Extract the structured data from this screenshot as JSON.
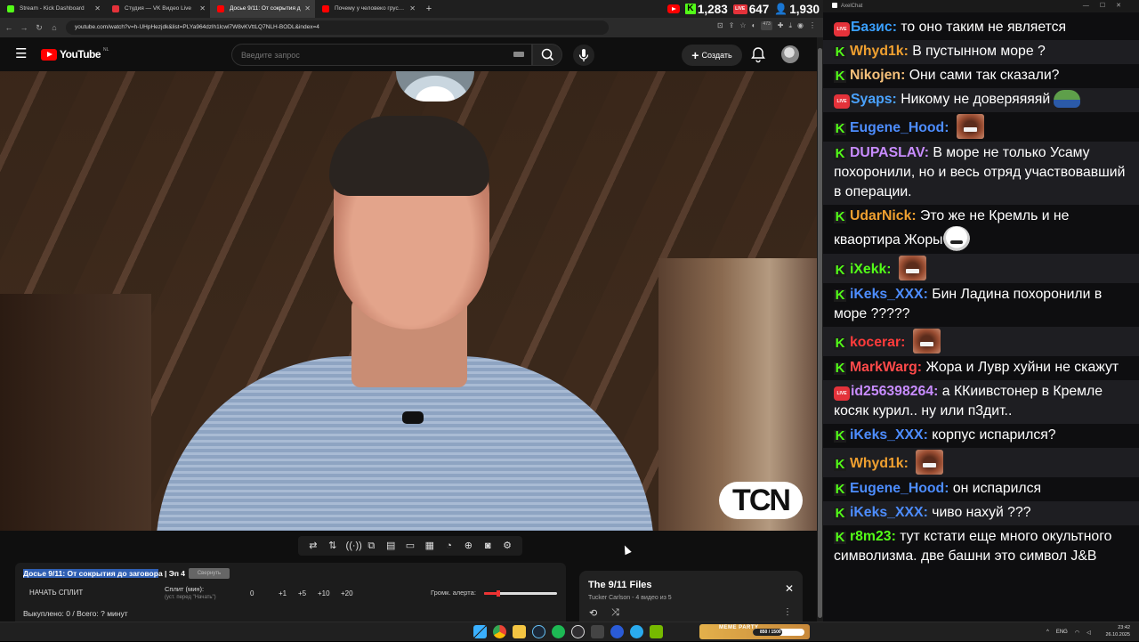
{
  "browser": {
    "tabs": [
      {
        "title": "Stream - Kick Dashboard",
        "color": "#53fc18",
        "active": false
      },
      {
        "title": "Студия — VK Видео Live",
        "color": "#e4323a",
        "active": false
      },
      {
        "title": "Досье 9/11: От сокрытия д",
        "color": "#ff0000",
        "active": true
      },
      {
        "title": "Почему у человеко грустно г",
        "color": "#ff0000",
        "active": false
      }
    ],
    "stats": {
      "kick_viewers": "1,283",
      "vk_viewers": "647",
      "total_viewers": "1,930"
    },
    "url": "youtube.com/watch?v=h-UHpHezjdk&list=PLYa964dzlh1lcwl7W8vKVttLQ7NLH-BODL&index=4",
    "extension_badge": "473"
  },
  "youtube": {
    "logo_text": "YouTube",
    "country_code": "NL",
    "search_placeholder": "Введите запрос",
    "create_label": "Создать"
  },
  "video": {
    "watermark": "TCN"
  },
  "splits": {
    "title_highlighted": "Досье 9/11: От сокрытия до заговор",
    "title_rest": "а | Эп 4",
    "badge": "Свернуть",
    "start_label": "НАЧАТЬ СПЛИТ",
    "split_label": "Сплит (мин):",
    "split_hint": "(уст. перед \"Начать\")",
    "split_value": "0",
    "increments": [
      "+1",
      "+5",
      "+10",
      "+20"
    ],
    "alert_label": "Громк. алерта:",
    "alert_volume": 0.2,
    "redeemed": "Выкуплено: 0 / Всего: ? минут"
  },
  "playlist": {
    "title": "The 9/11 Files",
    "subtitle": "Tucker Carlson - 4 видео из 5"
  },
  "chat": {
    "window_title": "AxelChat",
    "messages": [
      {
        "platform": "vk",
        "user": "Базис",
        "color": "#3aa0ff",
        "text": "то оно таким не является",
        "emote": ""
      },
      {
        "platform": "kick",
        "user": "Whyd1k",
        "color": "#f0a030",
        "text": "В пустынном море ?",
        "emote": ""
      },
      {
        "platform": "kick",
        "user": "Nikojen",
        "color": "#f5c07a",
        "text": "Они сами так сказали?",
        "emote": ""
      },
      {
        "platform": "vk",
        "user": "Syaps",
        "color": "#4aa3ff",
        "text": "Никому не доверяяяяй",
        "emote": "frog"
      },
      {
        "platform": "kick",
        "user": "Eugene_Hood",
        "color": "#4d8dff",
        "text": "",
        "emote": "face"
      },
      {
        "platform": "kick",
        "user": "DUPASLAV",
        "color": "#c88cff",
        "text": "В море не только Усаму похоронили, но и весь отряд участвовавший в операции.",
        "emote": ""
      },
      {
        "platform": "kick",
        "user": "UdarNick",
        "color": "#f0a030",
        "text": "Это же не Кремль и не кваортира Жоры",
        "emote": "joker"
      },
      {
        "platform": "kick",
        "user": "iXekk",
        "color": "#53fc18",
        "text": "",
        "emote": "face"
      },
      {
        "platform": "kick",
        "user": "iKeks_XXX",
        "color": "#4d8dff",
        "text": "Бин Ладина похоронили в море ?????",
        "emote": ""
      },
      {
        "platform": "kick",
        "user": "kocerar",
        "color": "#ff3b3b",
        "text": "",
        "emote": "face"
      },
      {
        "platform": "kick",
        "user": "MarkWarg",
        "color": "#ff4a4a",
        "text": "Жора и Лувр хуйни не скажут",
        "emote": ""
      },
      {
        "platform": "vk",
        "user": "id256398264",
        "color": "#c88cff",
        "text": "а ККиивстонер в Кремле косяк курил.. ну или п3дит..",
        "emote": ""
      },
      {
        "platform": "kick",
        "user": "iKeks_XXX",
        "color": "#4d8dff",
        "text": "корпус испарился?",
        "emote": ""
      },
      {
        "platform": "kick",
        "user": "Whyd1k",
        "color": "#f0a030",
        "text": "",
        "emote": "face"
      },
      {
        "platform": "kick",
        "user": "Eugene_Hood",
        "color": "#4d8dff",
        "text": "он испарился",
        "emote": ""
      },
      {
        "platform": "kick",
        "user": "iKeks_XXX",
        "color": "#4d8dff",
        "text": "чиво нахуй ???",
        "emote": ""
      },
      {
        "platform": "kick",
        "user": "r8m23",
        "color": "#53fc18",
        "text": "тут кстати еще много окультного символизма. две башни это символ J&B",
        "emote": ""
      }
    ]
  },
  "taskbar": {
    "meme_label": "MEME PARTY",
    "meme_count": "850 / 1500",
    "meme_progress": 0.57,
    "lang": "ENG",
    "time": "23:42",
    "date": "26.10.2025"
  }
}
